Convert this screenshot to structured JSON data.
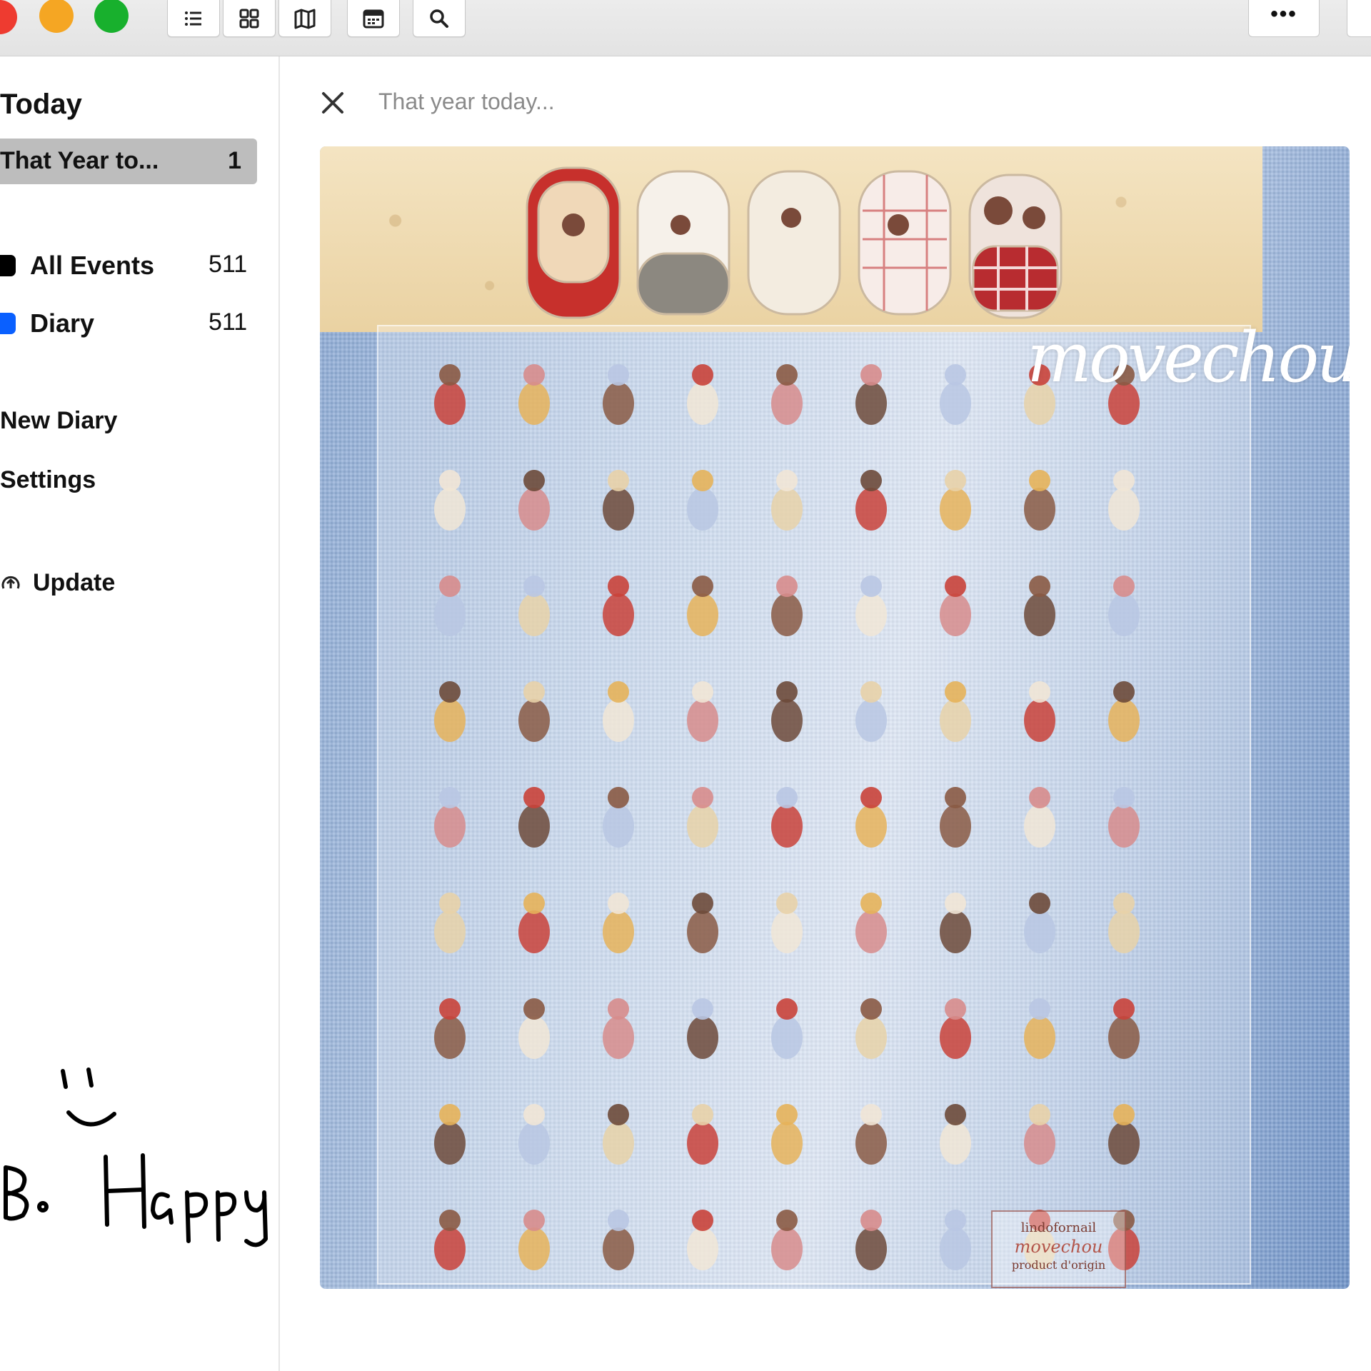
{
  "toolbar": {
    "buttons": [
      "list-icon",
      "grid-icon",
      "map-icon",
      "calendar-icon",
      "search-icon"
    ],
    "more_label": "•••"
  },
  "sidebar": {
    "heading": "Today",
    "selected": {
      "label": "That Year to...",
      "count": "1"
    },
    "calendars": [
      {
        "label": "All Events",
        "count": "511",
        "color": "#000000"
      },
      {
        "label": "Diary",
        "count": "511",
        "color": "#0a60ff"
      }
    ],
    "new_diary": "New Diary",
    "settings": "Settings",
    "update": "Update",
    "handwriting": ":) Be Happy"
  },
  "main": {
    "title": "That year today...",
    "photo": {
      "watermark": "movechou",
      "label_line1": "lindofornail",
      "label_line2": "movechou",
      "label_line3": "product d'origin"
    }
  },
  "colors": {
    "selected_bg": "#bdbdbd",
    "close_red": "#ee3b30",
    "minimize_yellow": "#f5a623",
    "zoom_green": "#18b02d"
  }
}
